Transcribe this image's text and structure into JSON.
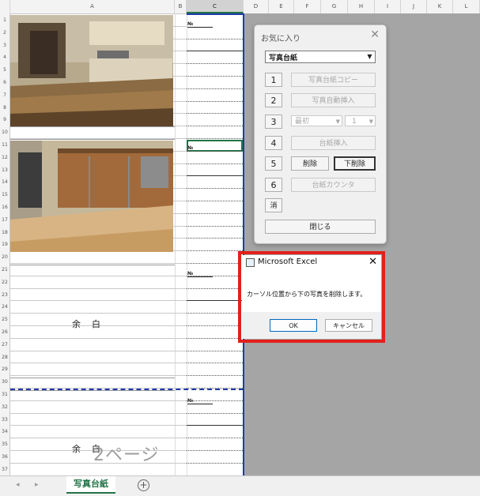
{
  "columns": [
    "A",
    "B",
    "C",
    "D",
    "E",
    "F",
    "G",
    "H",
    "I",
    "J",
    "K",
    "L"
  ],
  "rows": [
    "1",
    "2",
    "3",
    "4",
    "5",
    "6",
    "7",
    "8",
    "9",
    "10",
    "11",
    "12",
    "13",
    "14",
    "15",
    "16",
    "17",
    "18",
    "19",
    "20",
    "21",
    "22",
    "23",
    "24",
    "25",
    "26",
    "27",
    "28",
    "29",
    "30",
    "31",
    "32",
    "33",
    "34",
    "35",
    "36",
    "37"
  ],
  "sheet": {
    "number_mark": "№",
    "blank_text": "余白",
    "page_watermark": "2ページ"
  },
  "tabs": {
    "active": "写真台紙",
    "add": "+",
    "prev": "◂",
    "next": "▸"
  },
  "favorites_form": {
    "title": "お気に入り",
    "close": "✕",
    "combo_value": "写真台紙",
    "combo_arrow": "▼",
    "rows": [
      {
        "num": "1",
        "action": "写真台紙コピー"
      },
      {
        "num": "2",
        "action": "写真自動挿入"
      },
      {
        "num": "3",
        "select1": "最初",
        "select2": "1"
      },
      {
        "num": "4",
        "action": "台紙挿入"
      },
      {
        "num": "5",
        "delete": "削除",
        "delete_below": "下削除"
      },
      {
        "num": "6",
        "action": "台紙カウンタ"
      }
    ],
    "clear": "消",
    "close_button": "閉じる"
  },
  "msgbox": {
    "title": "Microsoft Excel",
    "close": "✕",
    "message": "カーソル位置から下の写真を削除します。",
    "ok": "OK",
    "cancel": "キャンセル"
  },
  "colors": {
    "excel_green": "#217346",
    "highlight_red": "#e3201b",
    "page_border_blue": "#1f3ca8"
  }
}
